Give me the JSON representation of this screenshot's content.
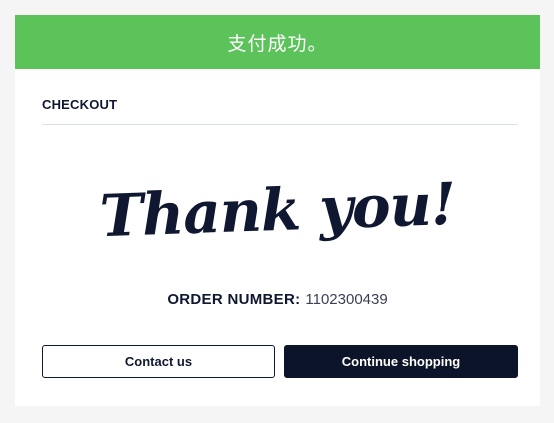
{
  "banner": {
    "text": "支付成功。",
    "color": "#5cc25a"
  },
  "checkout": {
    "title": "CHECKOUT"
  },
  "thank_you": {
    "text": "Thank you!"
  },
  "order": {
    "label": "ORDER NUMBER:",
    "number": "1102300439"
  },
  "buttons": {
    "contact_label": "Contact us",
    "continue_label": "Continue shopping"
  },
  "colors": {
    "primary": "#0b1428",
    "divider": "#d4e1e7"
  }
}
